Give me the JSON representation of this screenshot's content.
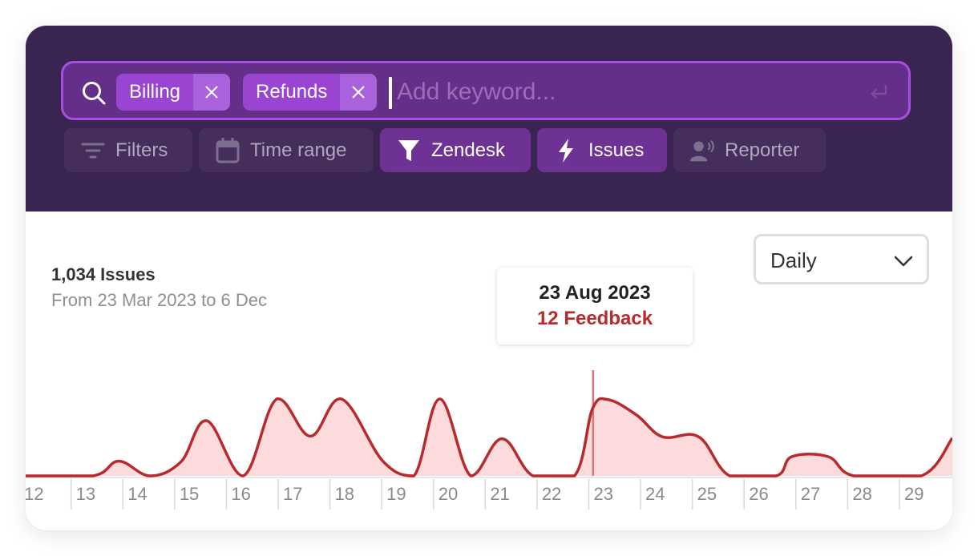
{
  "search": {
    "chips": [
      "Billing",
      "Refunds"
    ],
    "placeholder": "Add keyword..."
  },
  "toolbar": {
    "filters_label": "Filters",
    "time_range_label": "Time range",
    "zendesk_label": "Zendesk",
    "issues_label": "Issues",
    "reporter_label": "Reporter"
  },
  "summary": {
    "title": "1,034 Issues",
    "subtitle": "From 23 Mar 2023 to 6 Dec"
  },
  "granularity": {
    "selected": "Daily"
  },
  "tooltip": {
    "date": "23 Aug 2023",
    "count_label": "12 Feedback"
  },
  "colors": {
    "header_bg": "#3a2552",
    "chip_bg": "#9a45d1",
    "active_pill": "#6e3194",
    "line": "#b72a2e",
    "fill": "#fddadb"
  },
  "chart_data": {
    "type": "area",
    "x_ticks": [
      "12",
      "13",
      "14",
      "15",
      "16",
      "17",
      "18",
      "19",
      "20",
      "21",
      "22",
      "23",
      "24",
      "25",
      "26",
      "27",
      "28",
      "29"
    ],
    "x_range": [
      11.7,
      29.6
    ],
    "y_range": [
      0,
      12
    ],
    "highlight_x": 22.66,
    "points": [
      [
        11.7,
        0
      ],
      [
        13.0,
        0
      ],
      [
        13.5,
        2.3
      ],
      [
        14.1,
        0
      ],
      [
        14.7,
        2.2
      ],
      [
        15.2,
        8.6
      ],
      [
        15.9,
        0
      ],
      [
        16.55,
        12
      ],
      [
        17.2,
        6.2
      ],
      [
        17.8,
        12
      ],
      [
        18.6,
        2.3
      ],
      [
        19.2,
        0
      ],
      [
        19.7,
        12
      ],
      [
        20.3,
        0
      ],
      [
        20.9,
        5.8
      ],
      [
        21.5,
        0
      ],
      [
        22.3,
        0
      ],
      [
        22.65,
        10.5
      ],
      [
        22.95,
        11.9
      ],
      [
        23.5,
        9.5
      ],
      [
        24.0,
        6.1
      ],
      [
        24.7,
        6.1
      ],
      [
        25.3,
        0
      ],
      [
        26.2,
        0
      ],
      [
        26.5,
        3.0
      ],
      [
        27.2,
        3.0
      ],
      [
        27.7,
        0
      ],
      [
        29.0,
        0
      ],
      [
        29.6,
        5.9
      ]
    ]
  }
}
